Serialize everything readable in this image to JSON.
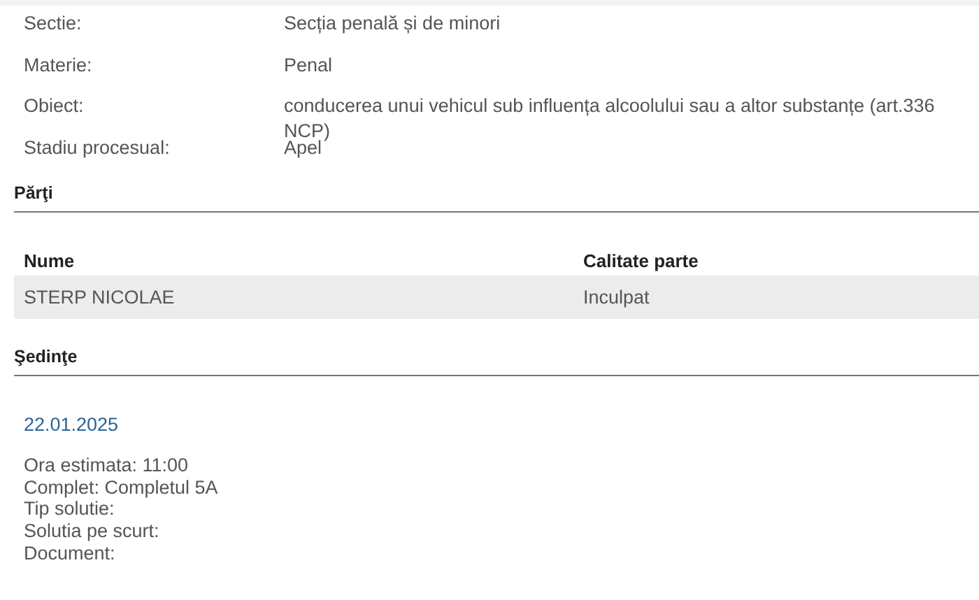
{
  "details": [
    {
      "label": "Sectie:",
      "value": "Secția penală și de minori"
    },
    {
      "label": "Materie:",
      "value": "Penal"
    },
    {
      "label": "Obiect:",
      "value": "conducerea unui vehicul sub influența alcoolului sau a altor substanțe (art.336 NCP)"
    },
    {
      "label": "Stadiu procesual:",
      "value": "Apel"
    }
  ],
  "parties": {
    "title": "Părţi",
    "columns": [
      "Nume",
      "Calitate parte"
    ],
    "rows": [
      [
        "STERP NICOLAE",
        "Inculpat"
      ]
    ]
  },
  "hearings": {
    "title": "Şedinţe",
    "items": [
      {
        "date": "22.01.2025",
        "lines": [
          "Ora estimata: 11:00",
          "Complet: Completul 5A",
          "Tip solutie:",
          "Solutia pe scurt:",
          "Document:"
        ]
      }
    ]
  }
}
